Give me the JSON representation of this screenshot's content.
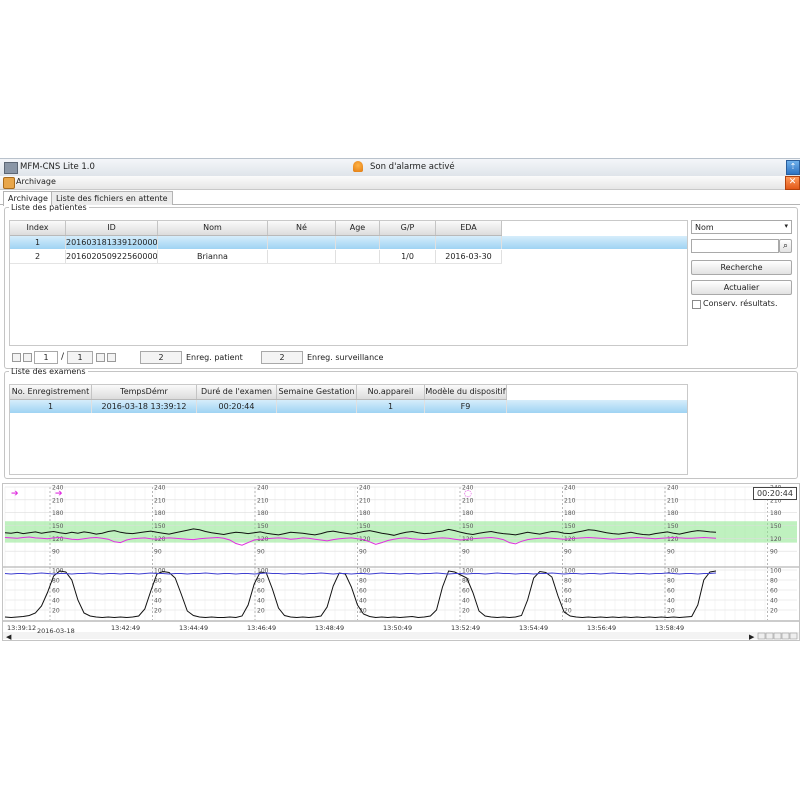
{
  "window": {
    "app_title": "MFM-CNS Lite 1.0",
    "alarm_status": "Son d'alarme activé"
  },
  "panel": {
    "title": "Archivage"
  },
  "tabs": [
    {
      "label": "Archivage",
      "active": true
    },
    {
      "label": "Liste des fichiers en attente",
      "active": false
    }
  ],
  "patients": {
    "group_label": "Liste des patientes",
    "columns": [
      "Index",
      "ID",
      "Nom",
      "Né",
      "Age",
      "G/P",
      "EDA"
    ],
    "rows": [
      {
        "index": "1",
        "id": "2016031813391200001",
        "nom": "",
        "ne": "",
        "age": "",
        "gp": "",
        "eda": "",
        "selected": true
      },
      {
        "index": "2",
        "id": "2016020509225600001",
        "nom": "Brianna",
        "ne": "",
        "age": "",
        "gp": "1/0",
        "eda": "2016-03-30",
        "selected": false
      }
    ],
    "pager": {
      "current": "1",
      "separator": "/",
      "total": "1"
    },
    "patient_count": "2",
    "patient_count_label": "Enreg. patient",
    "surveillance_count": "2",
    "surveillance_count_label": "Enreg. surveillance"
  },
  "search": {
    "field_select": "Nom",
    "search_value": "",
    "search_button": "Recherche",
    "refresh_button": "Actualier",
    "keep_results_label": "Conserv. résultats.",
    "keep_results_checked": false
  },
  "exams": {
    "group_label": "Liste des examens",
    "columns": [
      "No. Enregistrement",
      "TempsDémr",
      "Duré de l'examen",
      "Semaine Gestation",
      "No.appareil",
      "Modèle du dispositif"
    ],
    "rows": [
      {
        "no": "1",
        "start": "2016-03-18 13:39:12",
        "duration": "00:20:44",
        "week": "",
        "device_no": "1",
        "model": "F9",
        "selected": true
      }
    ]
  },
  "chart_data": {
    "type": "line",
    "elapsed": "00:20:44",
    "start_date": "2016-03-18",
    "time_ticks": [
      "13:39:12",
      "13:42:49",
      "13:44:49",
      "13:46:49",
      "13:48:49",
      "13:50:49",
      "13:52:49",
      "13:54:49",
      "13:56:49",
      "13:58:49"
    ],
    "fhr_panel": {
      "y_ticks": [
        90,
        120,
        150,
        180,
        210,
        240
      ],
      "ylim": [
        60,
        240
      ],
      "normal_band": [
        110,
        160
      ],
      "band_color": "#8be58b",
      "series": [
        {
          "color": "#111111",
          "values": [
            133,
            132,
            134,
            131,
            133,
            135,
            132,
            134,
            136,
            133,
            131,
            134,
            132,
            135,
            133,
            130,
            132,
            136,
            138,
            134,
            132,
            131,
            133,
            135,
            137,
            134,
            132,
            130,
            133,
            136,
            139,
            142,
            140,
            136,
            133,
            131,
            129,
            132,
            134,
            133,
            131,
            133,
            135,
            132,
            130,
            128,
            131,
            134,
            133,
            132,
            130,
            128,
            131,
            135,
            137,
            134,
            132,
            130,
            133,
            136,
            138,
            135,
            132,
            130,
            127,
            131,
            134,
            136,
            133,
            131,
            132,
            135,
            137,
            141,
            138,
            134,
            131,
            129,
            132,
            134,
            136,
            133,
            131,
            130,
            128,
            131,
            134,
            132,
            130,
            133,
            136,
            135,
            132,
            131,
            134,
            137,
            140,
            139,
            136,
            133,
            131,
            130,
            132,
            134,
            131,
            129,
            128,
            131,
            133,
            135,
            132,
            130,
            133,
            136,
            138,
            137,
            135,
            134
          ]
        },
        {
          "color": "#e030e0",
          "values": [
            122,
            121,
            120,
            122,
            123,
            121,
            120,
            119,
            121,
            122,
            120,
            118,
            117,
            119,
            121,
            122,
            120,
            118,
            112,
            110,
            116,
            119,
            120,
            121,
            119,
            118,
            120,
            121,
            120,
            119,
            118,
            117,
            119,
            120,
            121,
            122,
            120,
            116,
            108,
            104,
            110,
            116,
            118,
            119,
            120,
            121,
            120,
            118,
            119,
            121,
            120,
            118,
            116,
            114,
            117,
            119,
            120,
            121,
            119,
            117,
            112,
            106,
            110,
            115,
            118,
            120,
            121,
            119,
            118,
            117,
            119,
            120,
            121,
            120,
            118,
            116,
            118,
            119,
            120,
            121,
            122,
            120,
            117,
            110,
            107,
            113,
            117,
            119,
            120,
            121,
            120,
            119,
            118,
            119,
            120,
            121,
            122,
            121,
            120,
            119,
            118,
            119,
            120,
            121,
            122,
            121,
            120,
            119,
            120,
            121,
            122,
            121,
            120,
            120,
            121,
            122,
            121,
            120
          ]
        }
      ]
    },
    "toco_panel": {
      "y_ticks": [
        20,
        40,
        60,
        80,
        100
      ],
      "ylim": [
        0,
        100
      ],
      "series": [
        {
          "color": "#111111",
          "values": [
            6,
            5,
            6,
            7,
            9,
            14,
            28,
            55,
            88,
            98,
            96,
            80,
            40,
            14,
            8,
            6,
            5,
            6,
            5,
            6,
            5,
            6,
            8,
            22,
            58,
            92,
            97,
            95,
            84,
            52,
            18,
            9,
            6,
            5,
            6,
            5,
            5,
            6,
            5,
            8,
            30,
            72,
            96,
            94,
            62,
            24,
            9,
            6,
            5,
            6,
            5,
            6,
            8,
            26,
            68,
            94,
            92,
            66,
            30,
            12,
            7,
            5,
            6,
            5,
            6,
            5,
            6,
            7,
            5,
            6,
            8,
            20,
            66,
            98,
            96,
            90,
            84,
            55,
            18,
            8,
            6,
            5,
            6,
            5,
            6,
            9,
            40,
            84,
            97,
            95,
            86,
            48,
            16,
            8,
            6,
            5,
            6,
            5,
            6,
            5,
            6,
            5,
            6,
            5,
            6,
            5,
            6,
            5,
            6,
            5,
            6,
            5,
            6,
            7,
            30,
            80,
            96,
            98
          ]
        },
        {
          "color": "#4040d0",
          "values": [
            93,
            92,
            93,
            93,
            92,
            93,
            94,
            93,
            92,
            93,
            93,
            92,
            93,
            93,
            94,
            93,
            92,
            93,
            93,
            92,
            93,
            93,
            92,
            93,
            94,
            93,
            93,
            92,
            93,
            93,
            92,
            93,
            93,
            94,
            93,
            92,
            93,
            93,
            92,
            93,
            93,
            92,
            93,
            94,
            93,
            93,
            92,
            93,
            93,
            92,
            93,
            93,
            94,
            93,
            92,
            93,
            93,
            92,
            93,
            93,
            92,
            93,
            94,
            93,
            93,
            92,
            93,
            93,
            92,
            93,
            93,
            94,
            93,
            92,
            93,
            93,
            92,
            93,
            93,
            92,
            93,
            94,
            93,
            93,
            92,
            93,
            93,
            92,
            93,
            93,
            94,
            93,
            92,
            93,
            93,
            92,
            93,
            93,
            92,
            93,
            94,
            93,
            93,
            92,
            93,
            93,
            92,
            93,
            93,
            94,
            93,
            92,
            93,
            93,
            92,
            93,
            93,
            94
          ]
        }
      ]
    },
    "event_markers": [
      {
        "color": "#e030e0",
        "symbol": "➔"
      },
      {
        "color": "#e030e0",
        "symbol": "➔"
      },
      {
        "color": "#e030e0",
        "symbol": "◌"
      }
    ]
  }
}
